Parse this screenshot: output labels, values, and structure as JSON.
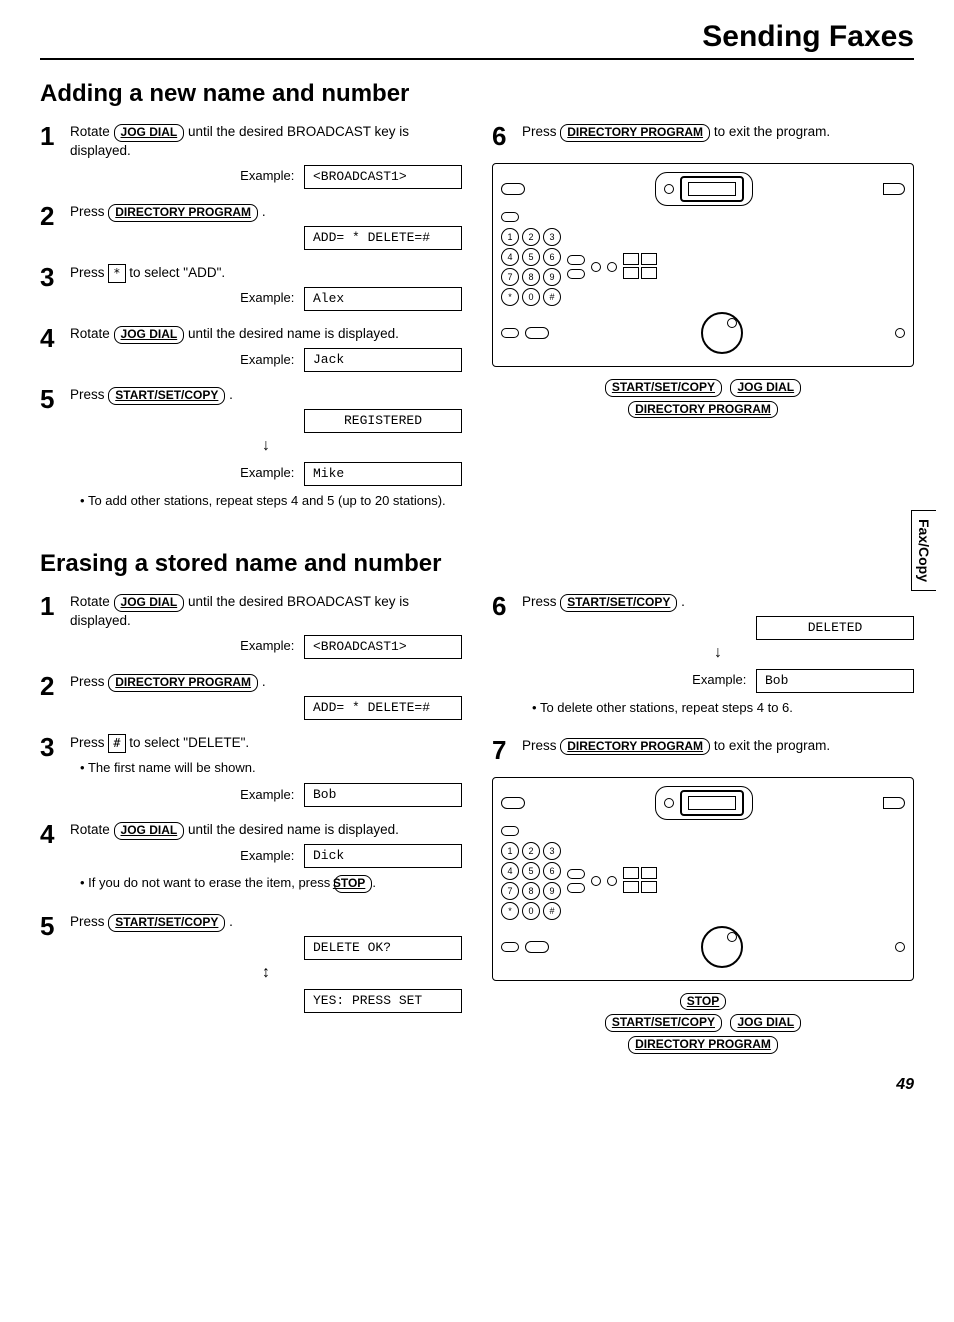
{
  "header": {
    "title": "Sending Faxes"
  },
  "sideTab": "Fax/Copy",
  "pageNum": "49",
  "buttons": {
    "jogDial": "JOG DIAL",
    "directoryProgram": "DIRECTORY PROGRAM",
    "startSetCopy": "START/SET/COPY",
    "stop": "STOP"
  },
  "keys": {
    "star": "*",
    "hash": "#"
  },
  "common": {
    "exampleLabel": "Example:"
  },
  "sectionA": {
    "title": "Adding a new name and number",
    "s1": {
      "text": " until the desired BROADCAST key is displayed.",
      "pre": "Rotate ",
      "lcd": "<BROADCAST1>"
    },
    "s2": {
      "pre": "Press ",
      "post": ".",
      "lcd": "ADD= *  DELETE=#"
    },
    "s3": {
      "pre": "Press ",
      "post": " to select \"ADD\".",
      "lcd": "Alex"
    },
    "s4": {
      "pre": "Rotate ",
      "post": " until the desired name is displayed.",
      "lcd": "Jack"
    },
    "s5": {
      "pre": "Press ",
      "post": ".",
      "lcdTop": "REGISTERED",
      "lcdBottom": "Mike"
    },
    "bullet": "To add other stations, repeat steps 4 and 5 (up to 20 stations).",
    "s6": {
      "pre": "Press ",
      "post": " to exit the program."
    }
  },
  "sectionB": {
    "title": "Erasing a stored name and number",
    "s1": {
      "pre": "Rotate ",
      "post": " until the desired BROADCAST key is displayed.",
      "lcd": "<BROADCAST1>"
    },
    "s2": {
      "pre": "Press ",
      "post": ".",
      "lcd": "ADD= *  DELETE=#"
    },
    "s3": {
      "pre": "Press ",
      "post": " to select \"DELETE\".",
      "bullet": "The first name will be shown.",
      "lcd": "Bob"
    },
    "s4": {
      "pre": "Rotate ",
      "post": " until the desired name is displayed.",
      "lcd": "Dick",
      "bullet": "If you do not want to erase the item, press "
    },
    "s5": {
      "pre": "Press ",
      "post": ".",
      "lcdTop": "DELETE OK?",
      "lcdBottom": "YES: PRESS SET"
    },
    "s6": {
      "pre": "Press ",
      "post": ".",
      "lcdTop": "DELETED",
      "lcdBottom": "Bob",
      "bullet": "To delete other stations, repeat steps 4 to 6."
    },
    "s7": {
      "pre": "Press ",
      "post": " to exit the program."
    }
  },
  "nums": [
    "1",
    "2",
    "3",
    "4",
    "5",
    "6",
    "7",
    "8",
    "9",
    "*",
    "0",
    "#"
  ]
}
